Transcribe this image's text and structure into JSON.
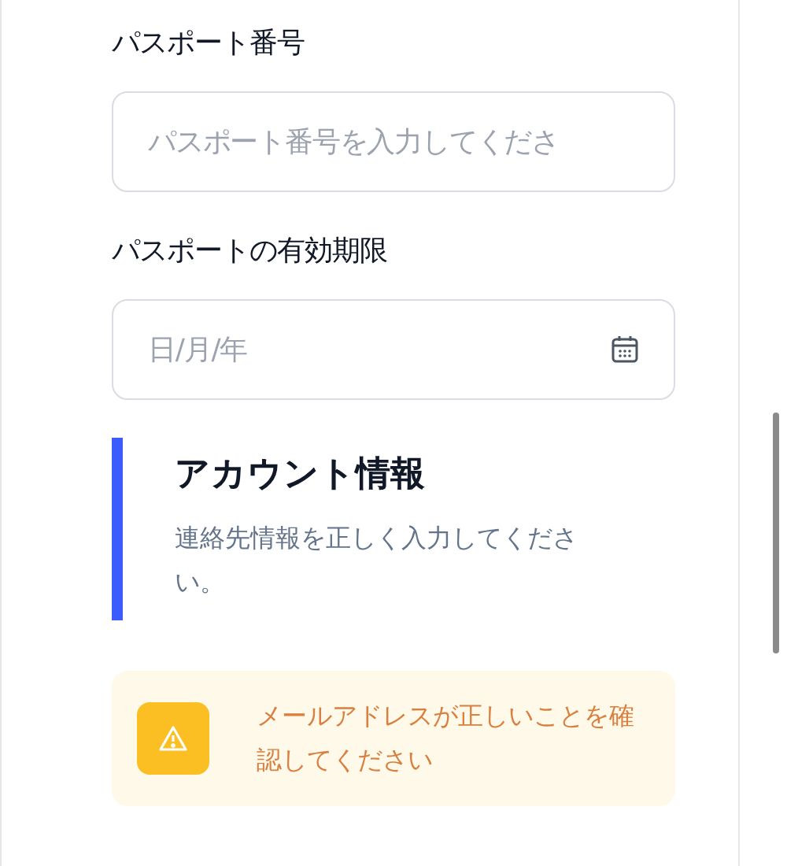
{
  "fields": [
    {
      "kind": "text",
      "label": "パスポート番号",
      "placeholder": "パスポート番号を入力してくださ"
    },
    {
      "kind": "date",
      "label": "パスポートの有効期限",
      "placeholder": "日/月/年"
    }
  ],
  "section": {
    "title": "アカウント情報",
    "description": "連絡先情報を正しく入力してください。"
  },
  "alert": {
    "kind": "warning",
    "message": "メールアドレスが正しいことを確認してください"
  }
}
